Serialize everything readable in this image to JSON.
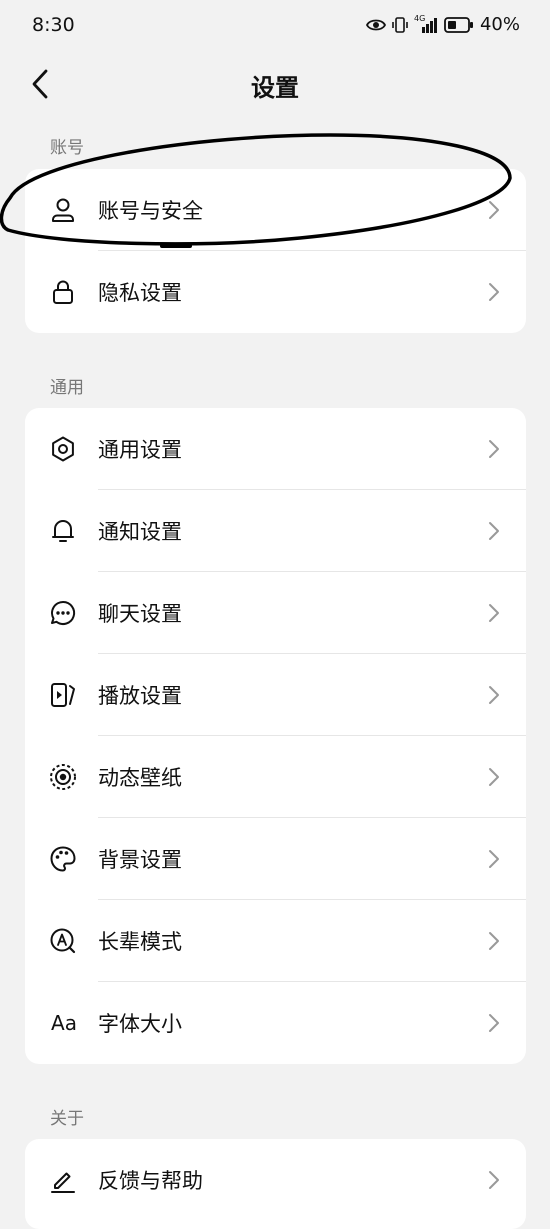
{
  "status": {
    "time": "8:30",
    "network": "4G",
    "battery": "40%"
  },
  "header": {
    "title": "设置"
  },
  "sections": [
    {
      "label": "账号",
      "items": [
        {
          "label": "账号与安全",
          "icon": "person-icon"
        },
        {
          "label": "隐私设置",
          "icon": "lock-icon"
        }
      ]
    },
    {
      "label": "通用",
      "items": [
        {
          "label": "通用设置",
          "icon": "gear-icon"
        },
        {
          "label": "通知设置",
          "icon": "bell-icon"
        },
        {
          "label": "聊天设置",
          "icon": "chat-bubble-icon"
        },
        {
          "label": "播放设置",
          "icon": "play-screen-icon"
        },
        {
          "label": "动态壁纸",
          "icon": "dynamic-wallpaper-icon"
        },
        {
          "label": "背景设置",
          "icon": "palette-icon"
        },
        {
          "label": "长辈模式",
          "icon": "elder-mode-icon"
        },
        {
          "label": "字体大小",
          "icon": "font-size-icon",
          "icon_text": "Aa"
        }
      ]
    },
    {
      "label": "关于",
      "items": [
        {
          "label": "反馈与帮助",
          "icon": "pen-icon"
        }
      ]
    }
  ]
}
